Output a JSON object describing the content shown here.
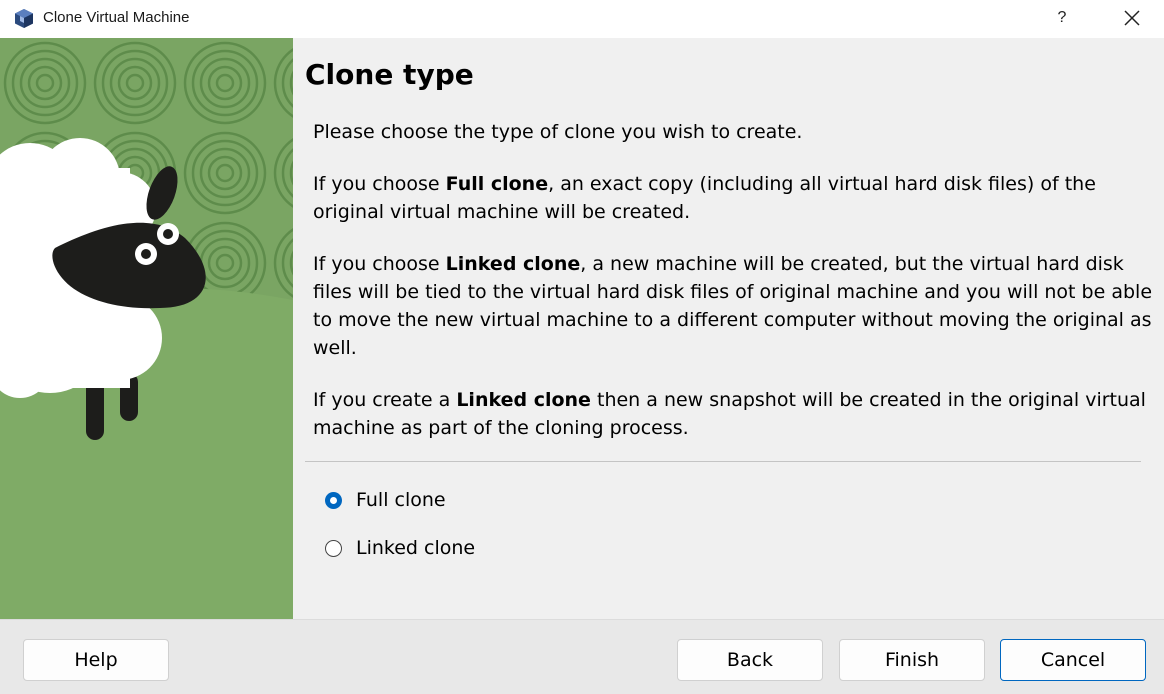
{
  "window": {
    "title": "Clone Virtual Machine",
    "help_glyph": "?",
    "icon": "virtualbox-icon"
  },
  "page": {
    "heading": "Clone type",
    "intro": "Please choose the type of clone you wish to create.",
    "full_para": {
      "pre": "If you choose ",
      "bold": "Full clone",
      "post": ", an exact copy (including all virtual hard disk files) of the original virtual machine will be created."
    },
    "linked_para": {
      "pre": "If you choose ",
      "bold": "Linked clone",
      "post": ", a new machine will be created, but the virtual hard disk files will be tied to the virtual hard disk files of original machine and you will not be able to move the new virtual machine to a different computer without moving the original as well."
    },
    "snapshot_para": {
      "pre": "If you create a ",
      "bold": "Linked clone",
      "post": " then a new snapshot will be created in the original virtual machine as part of the cloning process."
    }
  },
  "options": [
    {
      "label": "Full clone",
      "selected": true
    },
    {
      "label": "Linked clone",
      "selected": false
    }
  ],
  "buttons": {
    "help": "Help",
    "back": "Back",
    "finish": "Finish",
    "cancel": "Cancel"
  },
  "colors": {
    "accent": "#0067c0",
    "banner_green": "#7fa967",
    "swirl_green": "#5c8a4a"
  }
}
